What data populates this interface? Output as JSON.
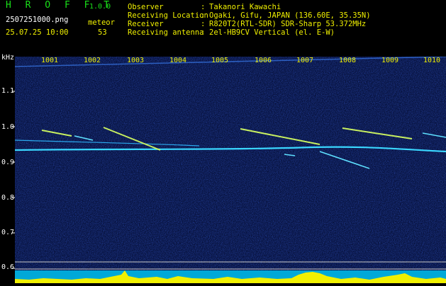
{
  "header": {
    "app_name": "H R O F F T",
    "version": "1.0.0",
    "filename": "2507251000.png",
    "datetime": "25.07.25 10:00",
    "meteor_label": "meteor",
    "meteor_count": "53",
    "observer_label": "Observer",
    "observer_value": "Takanori Kawachi",
    "location_label": "Receiving Location",
    "location_value": "Ogaki, Gifu, JAPAN (136.60E, 35.35N)",
    "receiver_label": "Receiver",
    "receiver_value": "R820T2(RTL-SDR) SDR-Sharp 53.372MHz",
    "antenna_label": "Receiving antenna",
    "antenna_value": "2el-HB9CV Vertical (el. E-W)",
    "colon": ":"
  },
  "axis": {
    "unit": "kHz",
    "y_ticks": [
      "1.1",
      "1.0",
      "0.9",
      "0.8",
      "0.7",
      "0.6"
    ],
    "minute_labels": [
      "1001",
      "1002",
      "1003",
      "1004",
      "1005",
      "1006",
      "1007",
      "1008",
      "1009",
      "1010"
    ]
  },
  "colors": {
    "spectrum_bg": "#06103a",
    "carrier": "#3ad7ff",
    "echo": "#c8f060",
    "text_yellow": "#f0f000",
    "text_green": "#19e019"
  }
}
